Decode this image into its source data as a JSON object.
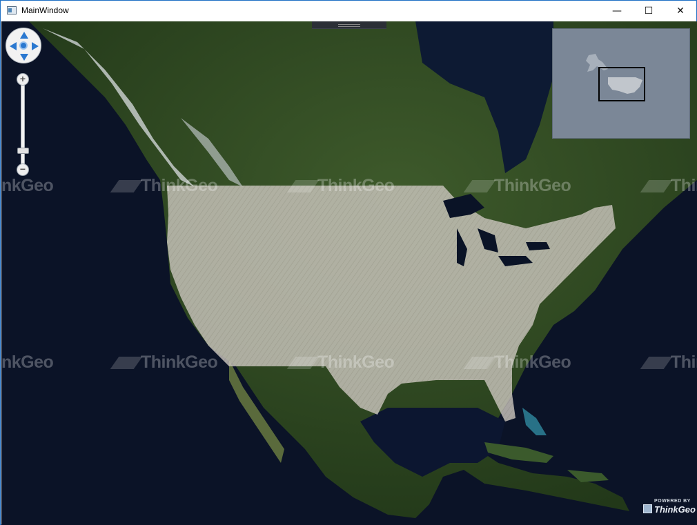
{
  "window": {
    "title": "MainWindow",
    "controls": {
      "minimize": "—",
      "maximize": "☐",
      "close": "✕"
    }
  },
  "map": {
    "watermark_text": "ThinkGeo",
    "highlight_region": "United States",
    "highlight_color": "#c9c4bd",
    "ocean_color": "#0c1428",
    "land_color": "#2f4a24"
  },
  "navigation": {
    "pan_icons": [
      "arrow-up-icon",
      "arrow-down-icon",
      "arrow-left-icon",
      "arrow-right-icon",
      "center-icon"
    ],
    "zoom_in_label": "+",
    "zoom_out_label": "−",
    "zoom_level_fraction": 0.15
  },
  "overview_map": {
    "background": "#7b8797"
  },
  "logo": {
    "powered_by": "POWERED BY",
    "brand": "ThinkGeo"
  }
}
